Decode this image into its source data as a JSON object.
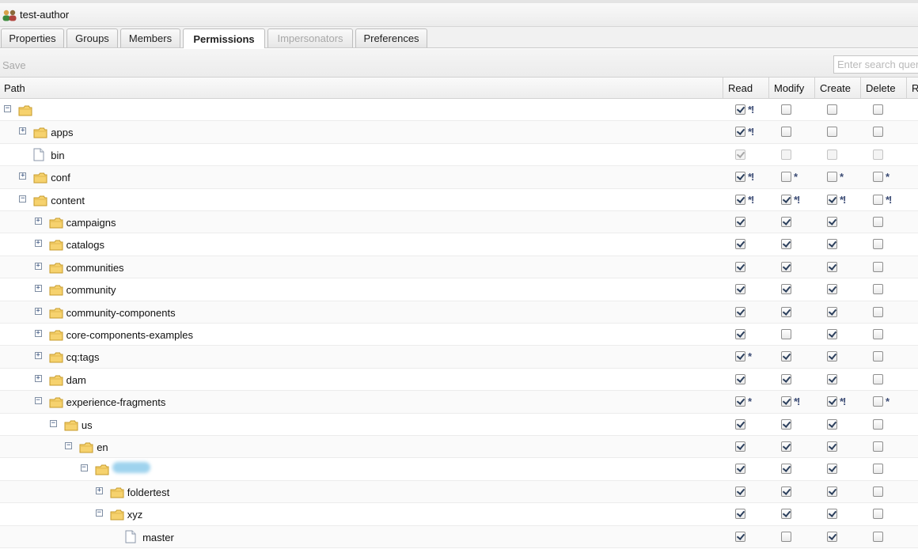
{
  "window": {
    "title": "test-author"
  },
  "tabs": [
    {
      "label": "Properties",
      "state": "normal"
    },
    {
      "label": "Groups",
      "state": "normal"
    },
    {
      "label": "Members",
      "state": "normal"
    },
    {
      "label": "Permissions",
      "state": "active"
    },
    {
      "label": "Impersonators",
      "state": "disabled"
    },
    {
      "label": "Preferences",
      "state": "normal"
    }
  ],
  "toolbar": {
    "save_label": "Save",
    "search_placeholder": "Enter search query"
  },
  "columns": {
    "path": "Path",
    "read": "Read",
    "modify": "Modify",
    "create": "Create",
    "delete": "Delete",
    "more": "R"
  },
  "rows": [
    {
      "label": "",
      "level": 0,
      "expander": "minus",
      "icon": "folder",
      "perms": [
        [
          true,
          "*!"
        ],
        [
          false,
          ""
        ],
        [
          false,
          ""
        ],
        [
          false,
          ""
        ]
      ]
    },
    {
      "label": "apps",
      "level": 1,
      "expander": "plus",
      "icon": "folder",
      "perms": [
        [
          true,
          "*!"
        ],
        [
          false,
          ""
        ],
        [
          false,
          ""
        ],
        [
          false,
          ""
        ]
      ]
    },
    {
      "label": "bin",
      "level": 1,
      "expander": "none",
      "icon": "doc",
      "disabled": true,
      "perms": [
        [
          true,
          ""
        ],
        [
          false,
          ""
        ],
        [
          false,
          ""
        ],
        [
          false,
          ""
        ]
      ]
    },
    {
      "label": "conf",
      "level": 1,
      "expander": "plus",
      "icon": "folder",
      "perms": [
        [
          true,
          "*!"
        ],
        [
          false,
          "*"
        ],
        [
          false,
          "*"
        ],
        [
          false,
          "*"
        ]
      ]
    },
    {
      "label": "content",
      "level": 1,
      "expander": "minus",
      "icon": "folder",
      "perms": [
        [
          true,
          "*!"
        ],
        [
          true,
          "*!"
        ],
        [
          true,
          "*!"
        ],
        [
          false,
          "*!"
        ]
      ]
    },
    {
      "label": "campaigns",
      "level": 2,
      "expander": "plus",
      "icon": "folder",
      "perms": [
        [
          true,
          ""
        ],
        [
          true,
          ""
        ],
        [
          true,
          ""
        ],
        [
          false,
          ""
        ]
      ]
    },
    {
      "label": "catalogs",
      "level": 2,
      "expander": "plus",
      "icon": "folder",
      "perms": [
        [
          true,
          ""
        ],
        [
          true,
          ""
        ],
        [
          true,
          ""
        ],
        [
          false,
          ""
        ]
      ]
    },
    {
      "label": "communities",
      "level": 2,
      "expander": "plus",
      "icon": "folder",
      "perms": [
        [
          true,
          ""
        ],
        [
          true,
          ""
        ],
        [
          true,
          ""
        ],
        [
          false,
          ""
        ]
      ]
    },
    {
      "label": "community",
      "level": 2,
      "expander": "plus",
      "icon": "folder",
      "perms": [
        [
          true,
          ""
        ],
        [
          true,
          ""
        ],
        [
          true,
          ""
        ],
        [
          false,
          ""
        ]
      ]
    },
    {
      "label": "community-components",
      "level": 2,
      "expander": "plus",
      "icon": "folder",
      "perms": [
        [
          true,
          ""
        ],
        [
          true,
          ""
        ],
        [
          true,
          ""
        ],
        [
          false,
          ""
        ]
      ]
    },
    {
      "label": "core-components-examples",
      "level": 2,
      "expander": "plus",
      "icon": "folder",
      "perms": [
        [
          true,
          ""
        ],
        [
          false,
          ""
        ],
        [
          true,
          ""
        ],
        [
          false,
          ""
        ]
      ]
    },
    {
      "label": "cq:tags",
      "level": 2,
      "expander": "plus",
      "icon": "folder",
      "perms": [
        [
          true,
          "*"
        ],
        [
          true,
          ""
        ],
        [
          true,
          ""
        ],
        [
          false,
          ""
        ]
      ]
    },
    {
      "label": "dam",
      "level": 2,
      "expander": "plus",
      "icon": "folder",
      "perms": [
        [
          true,
          ""
        ],
        [
          true,
          ""
        ],
        [
          true,
          ""
        ],
        [
          false,
          ""
        ]
      ]
    },
    {
      "label": "experience-fragments",
      "level": 2,
      "expander": "minus",
      "icon": "folder",
      "perms": [
        [
          true,
          "*"
        ],
        [
          true,
          "*!"
        ],
        [
          true,
          "*!"
        ],
        [
          false,
          "*"
        ]
      ]
    },
    {
      "label": "us",
      "level": 3,
      "expander": "minus",
      "icon": "folder",
      "perms": [
        [
          true,
          ""
        ],
        [
          true,
          ""
        ],
        [
          true,
          ""
        ],
        [
          false,
          ""
        ]
      ]
    },
    {
      "label": "en",
      "level": 4,
      "expander": "minus",
      "icon": "folder",
      "perms": [
        [
          true,
          ""
        ],
        [
          true,
          ""
        ],
        [
          true,
          ""
        ],
        [
          false,
          ""
        ]
      ]
    },
    {
      "label": "",
      "level": 5,
      "expander": "minus",
      "icon": "folder",
      "redacted": true,
      "perms": [
        [
          true,
          ""
        ],
        [
          true,
          ""
        ],
        [
          true,
          ""
        ],
        [
          false,
          ""
        ]
      ]
    },
    {
      "label": "foldertest",
      "level": 6,
      "expander": "plus",
      "icon": "folder",
      "perms": [
        [
          true,
          ""
        ],
        [
          true,
          ""
        ],
        [
          true,
          ""
        ],
        [
          false,
          ""
        ]
      ]
    },
    {
      "label": "xyz",
      "level": 6,
      "expander": "minus",
      "icon": "folder",
      "perms": [
        [
          true,
          ""
        ],
        [
          true,
          ""
        ],
        [
          true,
          ""
        ],
        [
          false,
          ""
        ]
      ]
    },
    {
      "label": "master",
      "level": 7,
      "expander": "none",
      "icon": "doc",
      "perms": [
        [
          true,
          ""
        ],
        [
          false,
          ""
        ],
        [
          true,
          ""
        ],
        [
          false,
          ""
        ]
      ]
    }
  ]
}
